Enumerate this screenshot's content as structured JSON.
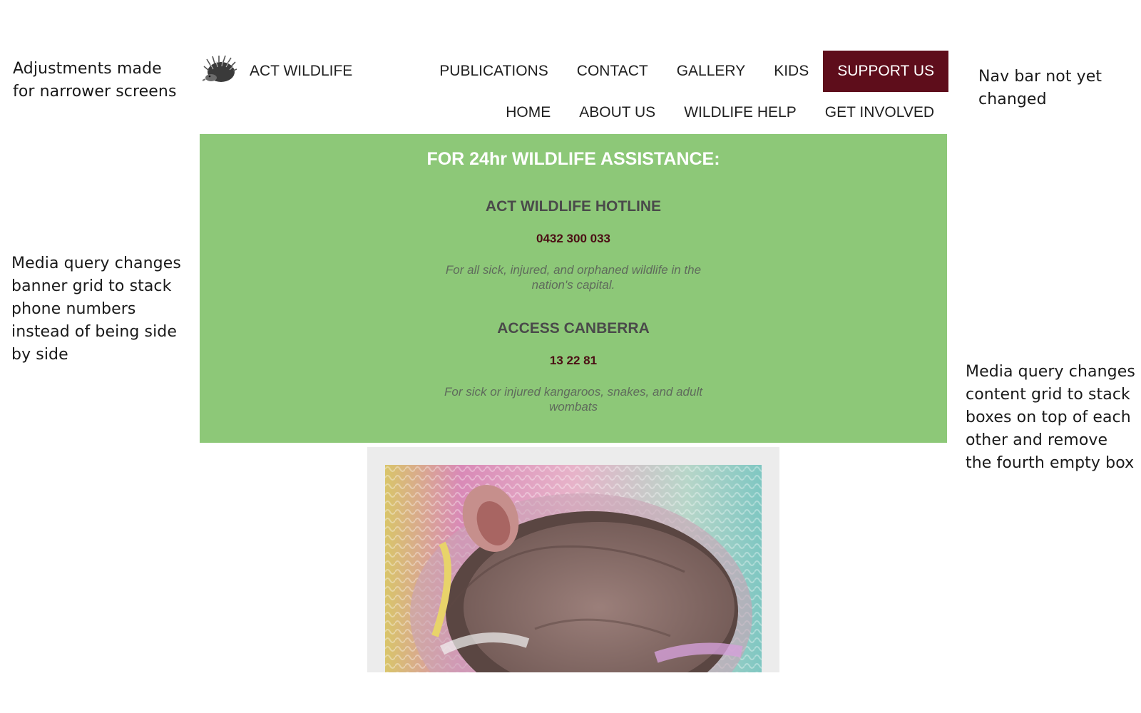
{
  "annotations": {
    "left_top": "Adjustments made for narrower screens",
    "left_mid": "Media query changes banner grid to stack phone numbers instead of being side by side",
    "right_top": "Nav bar not yet changed",
    "right_mid": "Media query changes content grid to stack boxes on top of each other and remove the fourth empty box"
  },
  "header": {
    "logo_icon": "echidna-logo-icon",
    "brand": "ACT WILDLIFE",
    "nav_row_1": [
      "PUBLICATIONS",
      "CONTACT",
      "GALLERY",
      "KIDS"
    ],
    "support_label": "SUPPORT US",
    "nav_row_2": [
      "HOME",
      "ABOUT US",
      "WILDLIFE HELP",
      "GET INVOLVED"
    ]
  },
  "banner": {
    "title": "FOR 24hr WILDLIFE ASSISTANCE:",
    "hotlines": [
      {
        "name": "ACT WILDLIFE HOTLINE",
        "number": "0432 300 033",
        "description": "For all sick, injured, and orphaned wildlife in the nation's capital."
      },
      {
        "name": "ACCESS CANBERRA",
        "number": "13 22 81",
        "description": "For sick or injured kangaroos, snakes, and adult wombats"
      }
    ]
  },
  "colors": {
    "banner_bg": "#8dc878",
    "support_bg": "#5e0d1b",
    "phone_number": "#4b0e14",
    "card_bg": "#ececec"
  }
}
